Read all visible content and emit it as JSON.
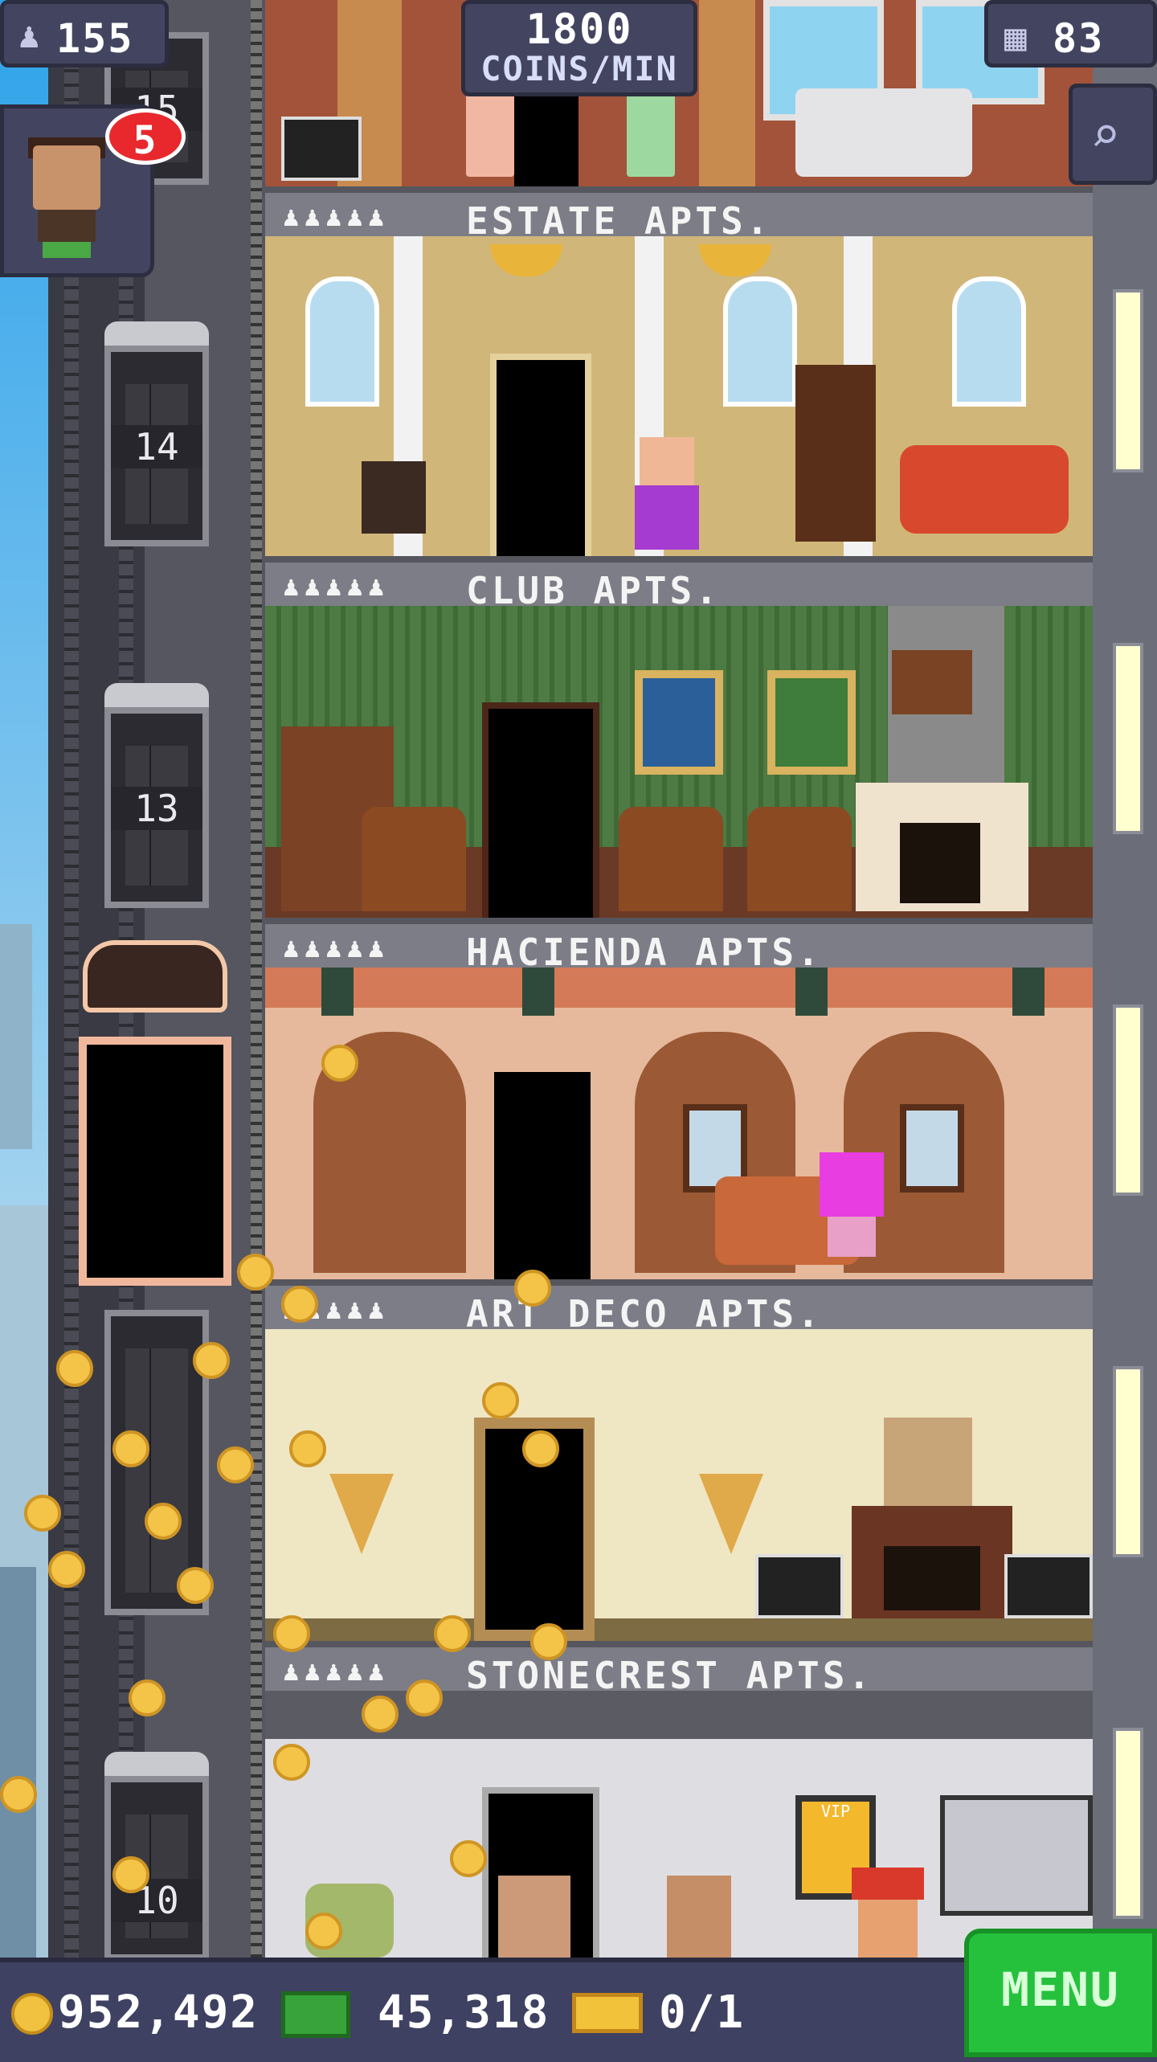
{
  "hud": {
    "population": "155",
    "coins_per_min_value": "1800",
    "coins_per_min_label": "COINS/MIN",
    "floor_count": "83",
    "mission_badge": "5"
  },
  "elevator": {
    "floor_numbers": [
      "15",
      "14",
      "13",
      "10"
    ]
  },
  "floors": [
    {
      "name": "ESTATE APTS.",
      "residents": "♟♟♟♟♟"
    },
    {
      "name": "CLUB APTS.",
      "residents": "♟♟♟♟♟"
    },
    {
      "name": "HACIENDA APTS.",
      "residents": "♟♟♟♟♟"
    },
    {
      "name": "ART DECO APTS.",
      "residents": "♟♟♟♟♟"
    },
    {
      "name": "STONECREST APTS.",
      "residents": "♟♟♟♟♟"
    }
  ],
  "wallet": {
    "coins": "952,492",
    "tower_bux": "45,318",
    "tickets": "0/1"
  },
  "menu_label": "MENU",
  "poster_text": "VIP",
  "colors": {
    "hud_bg": "#434560",
    "menu_green": "#25c13d",
    "coin_gold": "#f3c448"
  }
}
